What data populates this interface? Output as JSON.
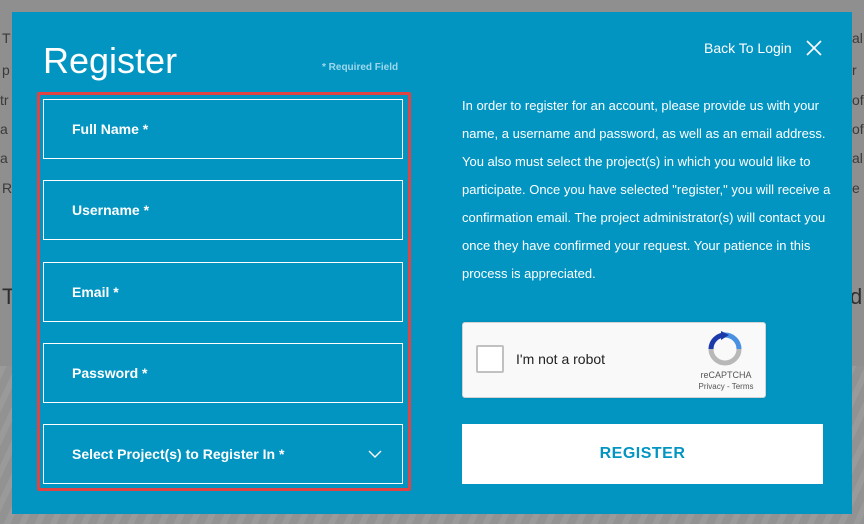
{
  "background": {
    "left_edge_letters": [
      "T",
      "p",
      "tr",
      "a",
      "a",
      "R"
    ],
    "right_edge_letters": [
      "al",
      "r",
      "of",
      "of",
      "al",
      "e"
    ],
    "big_left": "T",
    "big_right": "d."
  },
  "modal": {
    "title": "Register",
    "required_note": "* Required Field",
    "back_to_login": "Back To Login",
    "close_icon": "close-icon",
    "fields": [
      {
        "label": "Full Name *"
      },
      {
        "label": "Username *"
      },
      {
        "label": "Email *"
      },
      {
        "label": "Password *"
      },
      {
        "label": "Select Project(s) to Register In *",
        "icon": "chevron-down-icon"
      }
    ],
    "description": "In order to register for an account, please provide us with your name, a username and password, as well as an email address. You also must select the project(s) in which you would like to participate. Once you have selected \"register,\" you will receive a confirmation email. The project administrator(s) will contact you once they have confirmed your request. Your patience in this process is appreciated.",
    "captcha": {
      "label": "I'm not a robot",
      "brand": "reCAPTCHA",
      "links": "Privacy - Terms"
    },
    "register_button": "REGISTER"
  },
  "colors": {
    "modal_bg": "#0395c2",
    "highlight_border": "#e04343",
    "button_text": "#0395c2"
  }
}
